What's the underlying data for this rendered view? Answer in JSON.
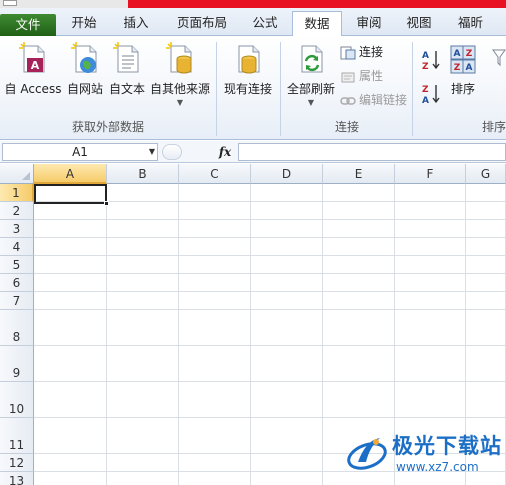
{
  "tabs": {
    "file": "文件",
    "home": "开始",
    "insert": "插入",
    "page_layout": "页面布局",
    "formulas": "公式",
    "data": "数据",
    "review": "审阅",
    "view": "视图",
    "foxit_pdf": "福昕PDF"
  },
  "ribbon": {
    "get_external": {
      "from_access": "自 Access",
      "from_web": "自网站",
      "from_text": "自文本",
      "from_other": "自其他来源",
      "group_label": "获取外部数据"
    },
    "existing_connections": "现有连接",
    "connections": {
      "refresh_all": "全部刷新",
      "connections": "连接",
      "properties": "属性",
      "edit_links": "编辑链接",
      "group_label": "连接"
    },
    "sort_filter": {
      "sort": "排序",
      "group_label": "排序"
    }
  },
  "formula_bar": {
    "name_box": "A1",
    "fx": "fx",
    "value": ""
  },
  "sheet": {
    "columns": [
      "A",
      "B",
      "C",
      "D",
      "E",
      "F",
      "G"
    ],
    "rows": [
      "1",
      "2",
      "3",
      "4",
      "5",
      "6",
      "7",
      "8",
      "9",
      "10",
      "11",
      "12",
      "13"
    ],
    "active_cell": "A1"
  },
  "watermark": {
    "title": "极光下载站",
    "url": "www.xz7.com"
  },
  "colors": {
    "file_tab": "#2a6c1f",
    "selection_header": "#f6cc6a",
    "title_red": "#e81123",
    "watermark_blue": "#1c6fc6"
  }
}
